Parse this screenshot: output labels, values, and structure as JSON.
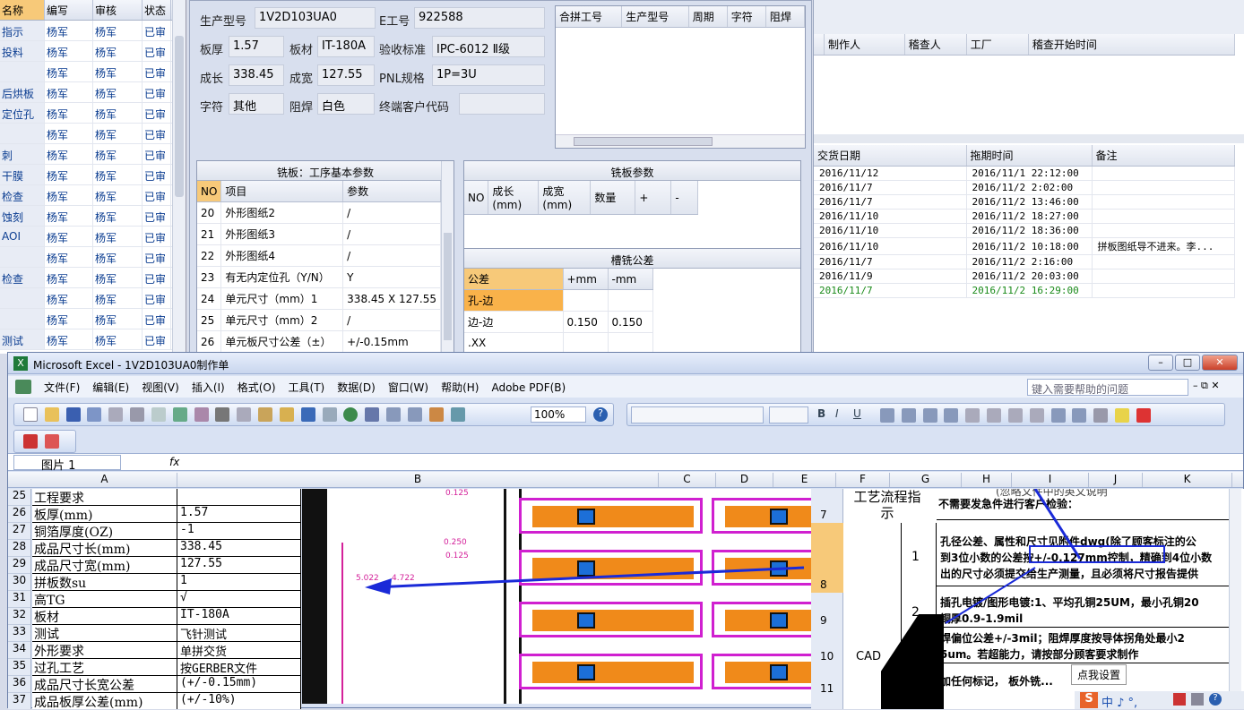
{
  "left_grid": {
    "headers": [
      "名称",
      "编写",
      "审核",
      "状态"
    ],
    "rows": [
      [
        "指示",
        "杨军",
        "杨军",
        "已审"
      ],
      [
        "投料",
        "杨军",
        "杨军",
        "已审"
      ],
      [
        "",
        "杨军",
        "杨军",
        "已审"
      ],
      [
        "后烘板",
        "杨军",
        "杨军",
        "已审"
      ],
      [
        "定位孔",
        "杨军",
        "杨军",
        "已审"
      ],
      [
        "",
        "杨军",
        "杨军",
        "已审"
      ],
      [
        "刺",
        "杨军",
        "杨军",
        "已审"
      ],
      [
        "干膜",
        "杨军",
        "杨军",
        "已审"
      ],
      [
        "检查",
        "杨军",
        "杨军",
        "已审"
      ],
      [
        "蚀刻",
        "杨军",
        "杨军",
        "已审"
      ],
      [
        "AOI",
        "杨军",
        "杨军",
        "已审"
      ],
      [
        "",
        "杨军",
        "杨军",
        "已审"
      ],
      [
        "检查",
        "杨军",
        "杨军",
        "已审"
      ],
      [
        "",
        "杨军",
        "杨军",
        "已审"
      ],
      [
        "",
        "杨军",
        "杨军",
        "已审"
      ],
      [
        "测试",
        "杨军",
        "杨军",
        "已审"
      ]
    ]
  },
  "form": {
    "model_label": "生产型号",
    "model": "1V2D103UA0",
    "e_label": "E工号",
    "e_no": "922588",
    "thick_label": "板厚",
    "thick": "1.57",
    "mat_label": "板材",
    "material": "IT-180A",
    "std_label": "验收标准",
    "standard": "IPC-6012 Ⅱ级",
    "len_label": "成长",
    "length": "338.45",
    "wid_label": "成宽",
    "width": "127.55",
    "pnl_label": "PNL规格",
    "pnl": "1P=3U",
    "char_label": "字符",
    "char": "其他",
    "mask_label": "阻焊",
    "mask": "白色",
    "cust_label": "终端客户代码",
    "cust": ""
  },
  "merge_table": {
    "headers": [
      "合拼工号",
      "生产型号",
      "周期",
      "字符",
      "阻焊"
    ]
  },
  "mill_basic": {
    "title": "铣板：工序基本参数",
    "headers": [
      "NO",
      "项目",
      "参数"
    ],
    "rows": [
      [
        "20",
        "外形图纸2",
        "/"
      ],
      [
        "21",
        "外形图纸3",
        "/"
      ],
      [
        "22",
        "外形图纸4",
        "/"
      ],
      [
        "23",
        "有无内定位孔（Y/N）",
        "Y"
      ],
      [
        "24",
        "单元尺寸（mm）1",
        "338.45 X 127.55"
      ],
      [
        "25",
        "单元尺寸（mm）2",
        "/"
      ],
      [
        "26",
        "单元板尺寸公差（±）",
        "+/-0.15mm"
      ]
    ]
  },
  "mill_params": {
    "title": "铣板参数",
    "headers": [
      "NO",
      "成长(mm)",
      "成宽(mm)",
      "数量",
      "+",
      "-"
    ]
  },
  "slot_tol": {
    "title": "槽铣公差",
    "headers": [
      "公差",
      "+mm",
      "-mm"
    ],
    "rows": [
      [
        "孔-边",
        "",
        ""
      ],
      [
        "边-边",
        "0.150",
        "0.150"
      ],
      [
        ".XX",
        "",
        ""
      ]
    ]
  },
  "right_top": {
    "headers": [
      "制作人",
      "稽查人",
      "工厂",
      "稽查开始时间"
    ]
  },
  "right_bottom": {
    "headers": [
      "交货日期",
      "拖期时间",
      "备注"
    ],
    "rows": [
      [
        "2016/11/12",
        "2016/11/1 22:12:00",
        ""
      ],
      [
        "2016/11/7",
        "2016/11/2 2:02:00",
        ""
      ],
      [
        "2016/11/7",
        "2016/11/2 13:46:00",
        ""
      ],
      [
        "2016/11/10",
        "2016/11/2 18:27:00",
        ""
      ],
      [
        "2016/11/10",
        "2016/11/2 18:36:00",
        ""
      ],
      [
        "2016/11/10",
        "2016/11/2 10:18:00",
        "拼板图纸导不进来。李..."
      ],
      [
        "2016/11/7",
        "2016/11/2 2:16:00",
        ""
      ],
      [
        "2016/11/9",
        "2016/11/2 20:03:00",
        ""
      ],
      [
        "2016/11/7",
        "2016/11/2 16:29:00",
        ""
      ]
    ],
    "highlight_color": "#1a8a1a"
  },
  "excel": {
    "title": "Microsoft Excel - 1V2D103UA0制作单",
    "menus": [
      "文件(F)",
      "编辑(E)",
      "视图(V)",
      "插入(I)",
      "格式(O)",
      "工具(T)",
      "数据(D)",
      "窗口(W)",
      "帮助(H)",
      "Adobe PDF(B)"
    ],
    "help_placeholder": "键入需要帮助的问题",
    "zoom": "100%",
    "name_box": "图片 1",
    "fx": "fx",
    "columns": [
      "A",
      "B",
      "C",
      "D",
      "E",
      "F",
      "G",
      "H",
      "I",
      "J",
      "K"
    ],
    "rows": [
      {
        "n": "25",
        "a": "工程要求",
        "b": ""
      },
      {
        "n": "26",
        "a": "板厚(mm)",
        "b": "1.57"
      },
      {
        "n": "27",
        "a": "铜箔厚度(OZ)",
        "b": "-1"
      },
      {
        "n": "28",
        "a": "成品尺寸长(mm)",
        "b": "338.45"
      },
      {
        "n": "29",
        "a": "成品尺寸宽(mm)",
        "b": "127.55"
      },
      {
        "n": "30",
        "a": "拼板数su",
        "b": "1"
      },
      {
        "n": "31",
        "a": "高TG",
        "b": "√"
      },
      {
        "n": "32",
        "a": "板材",
        "b": "IT-180A"
      },
      {
        "n": "33",
        "a": "测试",
        "b": "飞针测试"
      },
      {
        "n": "34",
        "a": "外形要求",
        "b": "单拼交货"
      },
      {
        "n": "35",
        "a": "过孔工艺",
        "b": "按GERBER文件"
      },
      {
        "n": "36",
        "a": "成品尺寸长宽公差",
        "b": "(+/-0.15mm)"
      },
      {
        "n": "37",
        "a": "成品板厚公差(mm)",
        "b": "(+/-10%)"
      }
    ],
    "right_rows": [
      "7",
      "8",
      "9",
      "10",
      "11"
    ],
    "flow_title": "工艺流程指示",
    "step1": "1",
    "step2": "2",
    "note_top": "不需要发急件进行客户检验：",
    "note_top2": "(忽略文件中的英文说明",
    "text1": "孔径公差、属性和尺寸见附件dwg(除了顾客标注的公",
    "text2": "到3位小数的公差按+/-0.127mm控制，精确到4位小数",
    "text3": "出的尺寸必须提交给生产测量，且必须将尺寸报告提供",
    "text4": "插孔电镀/图形电镀:1、平均孔铜25UM，最小孔铜20",
    "text5": "铜厚0.9-1.9mil",
    "text6": "焊偏位公差+/-3mil；阻焊厚度按导体拐角处最小2",
    "text7": "5um。若超能力，请按部分顾客要求制作",
    "text8": "加任何标记， 板外铣...",
    "cad": "CAD",
    "tooltip": "点我设置",
    "dim1": "5.022",
    "dim2": "4.722",
    "dim3": "0.250",
    "dim4": "0.125",
    "dim5": "0.125"
  }
}
